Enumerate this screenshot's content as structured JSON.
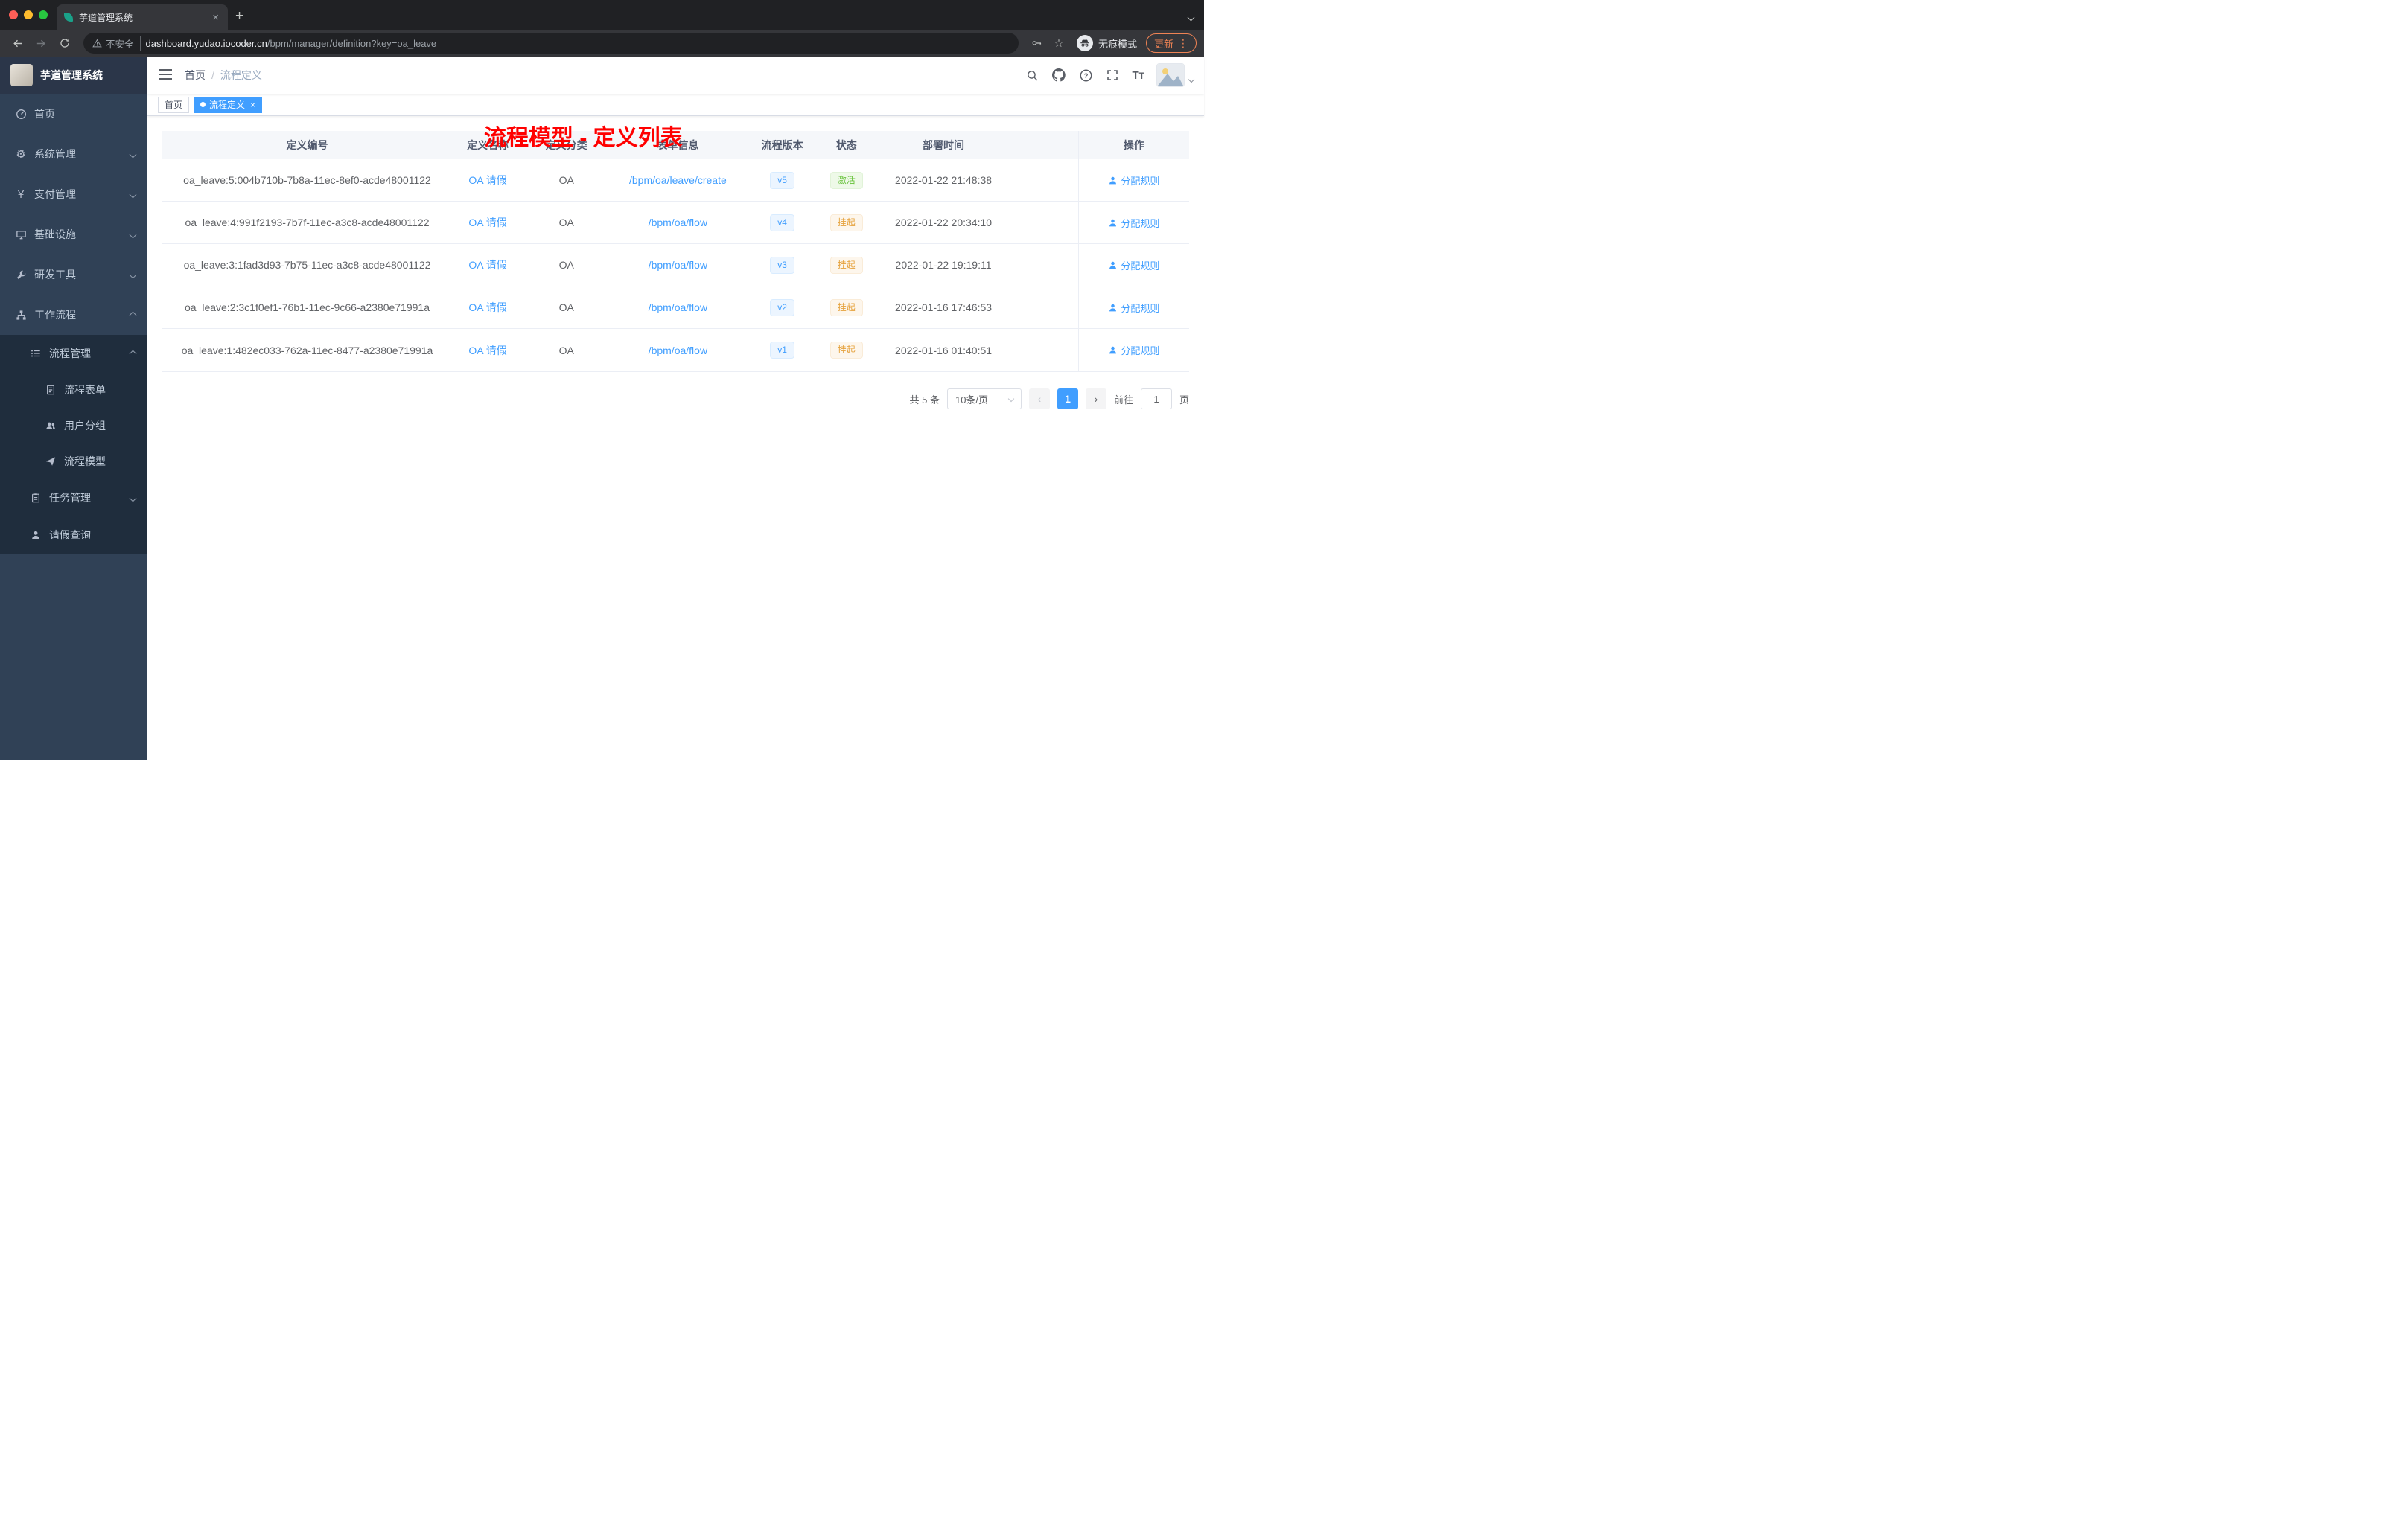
{
  "colors": {
    "primary": "#409eff",
    "success": "#67c23a",
    "warning": "#e6a23c",
    "annotation_red": "#ff0000",
    "sidebar_bg": "#304156",
    "submenu_bg": "#1f2d3d",
    "update_orange": "#ef8354"
  },
  "browser": {
    "tab_title": "芋道管理系统",
    "new_tab": "+",
    "close_tab": "×",
    "security_label": "不安全",
    "url_host": "dashboard.yudao.iocoder.cn",
    "url_path": "/bpm/manager/definition?key=oa_leave",
    "star": "☆",
    "incognito_label": "无痕模式",
    "update_label": "更新",
    "menu_dots": "⋮"
  },
  "sidebar": {
    "logo_title": "芋道管理系统",
    "menu": [
      {
        "label": "首页"
      },
      {
        "label": "系统管理"
      },
      {
        "label": "支付管理"
      },
      {
        "label": "基础设施"
      },
      {
        "label": "研发工具"
      },
      {
        "label": "工作流程"
      },
      {
        "label": "流程管理"
      },
      {
        "label": "流程表单"
      },
      {
        "label": "用户分组"
      },
      {
        "label": "流程模型"
      },
      {
        "label": "任务管理"
      },
      {
        "label": "请假查询"
      }
    ]
  },
  "navbar": {
    "breadcrumb_home": "首页",
    "breadcrumb_sep": "/",
    "breadcrumb_current": "流程定义"
  },
  "annotation": "流程模型 - 定义列表",
  "tags": {
    "home": "首页",
    "current": "流程定义",
    "close": "×"
  },
  "table": {
    "columns": [
      "定义编号",
      "定义名称",
      "定义分类",
      "表单信息",
      "流程版本",
      "状态",
      "部署时间",
      "操作"
    ],
    "rows": [
      {
        "id": "oa_leave:5:004b710b-7b8a-11ec-8ef0-acde48001122",
        "name": "OA 请假",
        "category": "OA",
        "form": "/bpm/oa/leave/create",
        "version": "v5",
        "status": "激活",
        "status_type": "success",
        "time": "2022-01-22 21:48:38",
        "action": "分配规则"
      },
      {
        "id": "oa_leave:4:991f2193-7b7f-11ec-a3c8-acde48001122",
        "name": "OA 请假",
        "category": "OA",
        "form": "/bpm/oa/flow",
        "version": "v4",
        "status": "挂起",
        "status_type": "warning",
        "time": "2022-01-22 20:34:10",
        "action": "分配规则"
      },
      {
        "id": "oa_leave:3:1fad3d93-7b75-11ec-a3c8-acde48001122",
        "name": "OA 请假",
        "category": "OA",
        "form": "/bpm/oa/flow",
        "version": "v3",
        "status": "挂起",
        "status_type": "warning",
        "time": "2022-01-22 19:19:11",
        "action": "分配规则"
      },
      {
        "id": "oa_leave:2:3c1f0ef1-76b1-11ec-9c66-a2380e71991a",
        "name": "OA 请假",
        "category": "OA",
        "form": "/bpm/oa/flow",
        "version": "v2",
        "status": "挂起",
        "status_type": "warning",
        "time": "2022-01-16 17:46:53",
        "action": "分配规则"
      },
      {
        "id": "oa_leave:1:482ec033-762a-11ec-8477-a2380e71991a",
        "name": "OA 请假",
        "category": "OA",
        "form": "/bpm/oa/flow",
        "version": "v1",
        "status": "挂起",
        "status_type": "warning",
        "time": "2022-01-16 01:40:51",
        "action": "分配规则"
      }
    ]
  },
  "pagination": {
    "total": "共 5 条",
    "page_size": "10条/页",
    "prev": "‹",
    "page": "1",
    "next": "›",
    "goto_label": "前往",
    "goto_value": "1",
    "goto_unit": "页"
  }
}
